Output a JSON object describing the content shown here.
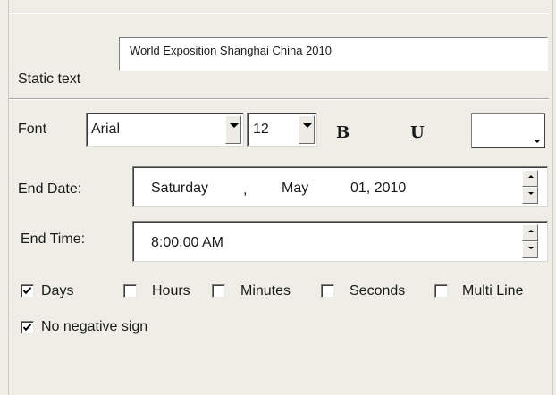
{
  "static_text": {
    "label": "Static text",
    "value": "World Exposition Shanghai China 2010"
  },
  "font": {
    "label": "Font",
    "family": "Arial",
    "size": "12",
    "bold_label": "B",
    "underline_label": "U",
    "color": "#ffffff"
  },
  "end_date": {
    "label": "End Date:",
    "weekday": "Saturday",
    "sep1": ",",
    "month": "May",
    "day_year": "01, 2010"
  },
  "end_time": {
    "label": "End Time:",
    "value": "8:00:00 AM"
  },
  "options": {
    "days": {
      "label": "Days",
      "checked": true
    },
    "hours": {
      "label": "Hours",
      "checked": false
    },
    "minutes": {
      "label": "Minutes",
      "checked": false
    },
    "seconds": {
      "label": "Seconds",
      "checked": false
    },
    "multi_line": {
      "label": "Multi Line",
      "checked": false
    },
    "no_negative": {
      "label": "No negative sign",
      "checked": true
    }
  }
}
